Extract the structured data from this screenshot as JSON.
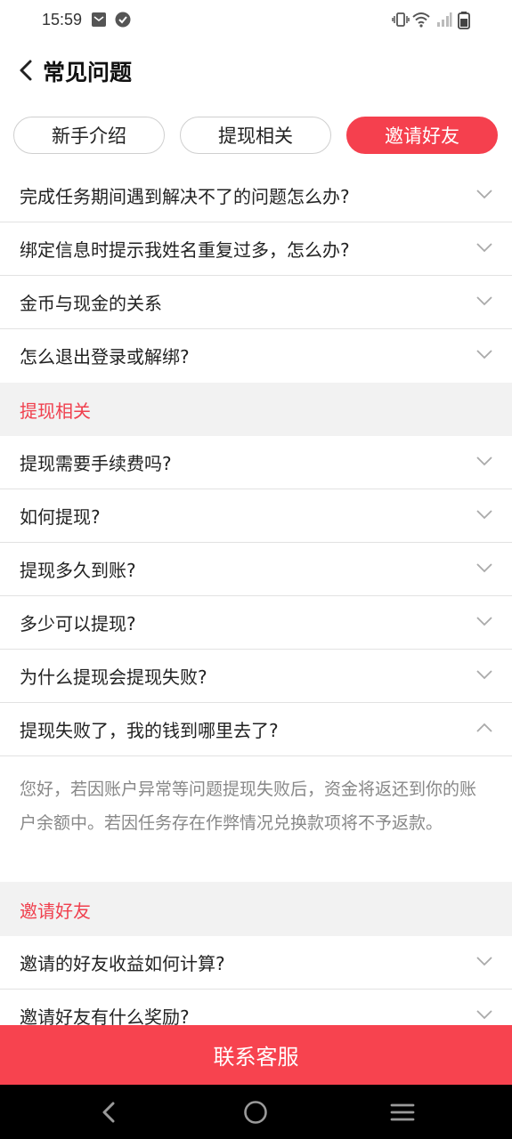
{
  "status_bar": {
    "time": "15:59"
  },
  "header": {
    "title": "常见问题"
  },
  "tabs": [
    {
      "label": "新手介绍",
      "active": false
    },
    {
      "label": "提现相关",
      "active": false
    },
    {
      "label": "邀请好友",
      "active": true
    }
  ],
  "faq": {
    "intro_items": [
      "完成任务期间遇到解决不了的问题怎么办?",
      "绑定信息时提示我姓名重复过多，怎么办?",
      "金币与现金的关系",
      "怎么退出登录或解绑?"
    ],
    "withdraw_section": "提现相关",
    "withdraw_items": [
      "提现需要手续费吗?",
      "如何提现?",
      "提现多久到账?",
      "多少可以提现?",
      "为什么提现会提现失败?",
      "提现失败了，我的钱到哪里去了?"
    ],
    "expanded_answer": "您好，若因账户异常等问题提现失败后，资金将返还到你的账户余额中。若因任务存在作弊情况兑换款项将不予返款。",
    "invite_section": "邀请好友",
    "invite_items": [
      "邀请的好友收益如何计算?",
      "邀请好友有什么奖励?"
    ]
  },
  "contact_button": "联系客服",
  "colors": {
    "accent": "#f5404e",
    "section_bg": "#f2f2f2",
    "answer_text": "#888888"
  }
}
